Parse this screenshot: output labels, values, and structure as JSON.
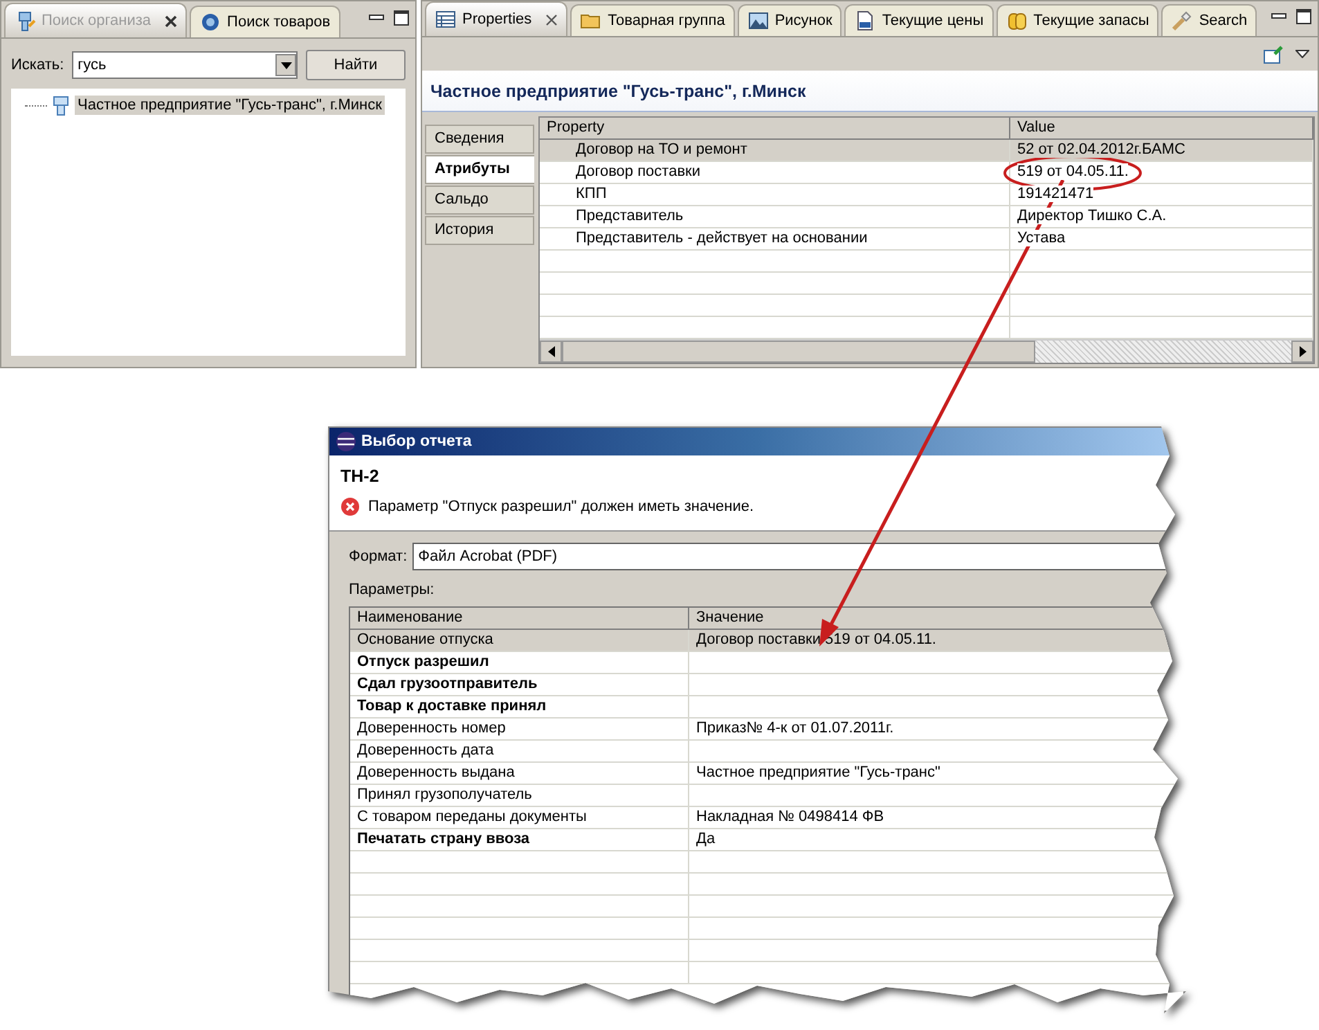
{
  "search_panel": {
    "tabs": [
      {
        "label": "Поиск организа",
        "selected": true,
        "closable": true
      },
      {
        "label": "Поиск товаров",
        "selected": false,
        "closable": false
      }
    ],
    "search_label": "Искать:",
    "search_value": "гусь",
    "find_button": "Найти",
    "tree": [
      {
        "label": "Частное предприятие \"Гусь-транс\", г.Минск",
        "selected": true
      }
    ]
  },
  "properties_panel": {
    "tabs": [
      {
        "label": "Properties",
        "selected": true,
        "closable": true
      },
      {
        "label": "Товарная группа",
        "selected": false,
        "closable": false
      },
      {
        "label": "Рисунок",
        "selected": false,
        "closable": false
      },
      {
        "label": "Текущие цены",
        "selected": false,
        "closable": false
      },
      {
        "label": "Текущие запасы",
        "selected": false,
        "closable": false
      },
      {
        "label": "Search",
        "selected": false,
        "closable": false
      }
    ],
    "title": "Частное предприятие \"Гусь-транс\", г.Минск",
    "side_tabs": [
      {
        "label": "Сведения",
        "selected": false
      },
      {
        "label": "Атрибуты",
        "selected": true
      },
      {
        "label": "Сальдо",
        "selected": false
      },
      {
        "label": "История",
        "selected": false
      }
    ],
    "columns": [
      "Property",
      "Value"
    ],
    "rows": [
      {
        "property": "Договор на ТО и ремонт",
        "value": "52 от 02.04.2012г.БАМС",
        "selected": true
      },
      {
        "property": "Договор поставки",
        "value": "519 от 04.05.11.",
        "selected": false
      },
      {
        "property": "КПП",
        "value": "191421471",
        "selected": false
      },
      {
        "property": "Представитель",
        "value": "Директор Тишко С.А.",
        "selected": false
      },
      {
        "property": "Представитель - действует на основании",
        "value": "Устава",
        "selected": false
      }
    ]
  },
  "dialog": {
    "title": "Выбор отчета",
    "heading": "ТН-2",
    "error": "Параметр \"Отпуск разрешил\" должен иметь значение.",
    "format_label": "Формат:",
    "format_value": "Файл Acrobat (PDF)",
    "params_label": "Параметры:",
    "columns": [
      "Наименование",
      "Значение"
    ],
    "rows": [
      {
        "name": "Основание отпуска",
        "value": "Договор поставки 519 от 04.05.11.",
        "required": false,
        "selected": true
      },
      {
        "name": "Отпуск разрешил",
        "value": "",
        "required": true,
        "selected": false
      },
      {
        "name": "Сдал грузоотправитель",
        "value": "",
        "required": true,
        "selected": false
      },
      {
        "name": "Товар к доставке принял",
        "value": "",
        "required": true,
        "selected": false
      },
      {
        "name": "Доверенность номер",
        "value": "Приказ№ 4-к от 01.07.2011г.",
        "required": false,
        "selected": false
      },
      {
        "name": "Доверенность дата",
        "value": "",
        "required": false,
        "selected": false
      },
      {
        "name": "Доверенность выдана",
        "value": "Частное предприятие \"Гусь-транс\"",
        "required": false,
        "selected": false
      },
      {
        "name": "Принял грузополучатель",
        "value": "",
        "required": false,
        "selected": false
      },
      {
        "name": "С товаром переданы документы",
        "value": "Накладная № 0498414 ФВ",
        "required": false,
        "selected": false
      },
      {
        "name": "Печатать страну ввоза",
        "value": "Да",
        "required": true,
        "selected": false
      }
    ]
  }
}
